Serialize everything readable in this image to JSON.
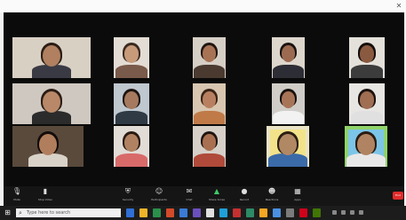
{
  "window": {
    "title": "",
    "close_icon": "close-icon"
  },
  "meeting": {
    "title": "",
    "participants": [
      {
        "name": "",
        "bg": "#d9d0c4",
        "skin": "#b08060",
        "hair": "#2a1d15",
        "shirt": "#3a3a44"
      },
      {
        "name": "",
        "bg": "#e3dcd4",
        "skin": "#c79a7a",
        "hair": "#3a2a20",
        "shirt": "#7a5a4a"
      },
      {
        "name": "",
        "bg": "#d6cfc6",
        "skin": "#a87355",
        "hair": "#1e1410",
        "shirt": "#4a3a30"
      },
      {
        "name": "",
        "bg": "#ddd6cc",
        "skin": "#9c6a50",
        "hair": "#1a1210",
        "shirt": "#2d2d35"
      },
      {
        "name": "",
        "bg": "#e4e0da",
        "skin": "#8a5a40",
        "hair": "#140e0c",
        "shirt": "#3c3c3c"
      },
      {
        "name": "",
        "bg": "#cfc8c0",
        "skin": "#b88868",
        "hair": "#2a1d15",
        "shirt": "#2b2b2b"
      },
      {
        "name": "",
        "bg": "#bfc7cf",
        "skin": "#a57a5e",
        "hair": "#1c1410",
        "shirt": "#2f3a45"
      },
      {
        "name": "",
        "bg": "#d8c6b0",
        "skin": "#b88060",
        "hair": "#3a2416",
        "shirt": "#c07a48"
      },
      {
        "name": "",
        "bg": "#d0cdc8",
        "skin": "#a87458",
        "hair": "#18110d",
        "shirt": "#f2f2f2"
      },
      {
        "name": "",
        "bg": "#e8e6e2",
        "skin": "#a06e52",
        "hair": "#1a1310",
        "shirt": "#e0e0e0"
      },
      {
        "name": "",
        "bg": "#5a4a3c",
        "skin": "#b07e5c",
        "hair": "#120c0a",
        "shirt": "#d8d2c8"
      },
      {
        "name": "",
        "bg": "#e2dcd6",
        "skin": "#b08262",
        "hair": "#2a1a12",
        "shirt": "#d86a6a"
      },
      {
        "name": "",
        "bg": "#d6d0c8",
        "skin": "#a87050",
        "hair": "#1e1410",
        "shirt": "#b04a3a"
      },
      {
        "name": "",
        "bg": "#e9e3c6",
        "skin": "#b08864",
        "hair": "#2a1e14",
        "shirt": "#3b6aa8",
        "poster": "#f2e38a"
      },
      {
        "name": "",
        "bg": "#8fd36a",
        "skin": "#b08462",
        "hair": "#2a1c12",
        "shirt": "#e8e8e8",
        "poster": "#7cc5e8"
      }
    ]
  },
  "controls": {
    "mute": {
      "icon": "microphone-icon",
      "label": "Mute"
    },
    "video": {
      "icon": "video-camera-icon",
      "label": "Stop Video"
    },
    "security": {
      "icon": "shield-icon",
      "label": "Security"
    },
    "participants": {
      "icon": "participants-icon",
      "label": "Participants"
    },
    "chat": {
      "icon": "chat-icon",
      "label": "Chat"
    },
    "share": {
      "icon": "share-screen-icon",
      "label": "Share Screen"
    },
    "record": {
      "icon": "record-icon",
      "label": "Record"
    },
    "reactions": {
      "icon": "reactions-icon",
      "label": "Reactions"
    },
    "apps": {
      "icon": "apps-icon",
      "label": "Apps"
    },
    "end": {
      "label": "End"
    }
  },
  "taskbar": {
    "search_placeholder": "Type here to search",
    "apps": [
      "#2f6fd6",
      "#f0b429",
      "#2a8f4a",
      "#d24a2a",
      "#3a7bd5",
      "#6b4fbb",
      "#e0e0e0",
      "#1f9fd8",
      "#c53030",
      "#2d8a66",
      "#f5a623",
      "#4a90e2",
      "#7b7b7b",
      "#d0021b",
      "#417505"
    ],
    "clock": ""
  },
  "colors": {
    "end_button": "#e02b2b",
    "meeting_bg": "#0b0b0b"
  }
}
